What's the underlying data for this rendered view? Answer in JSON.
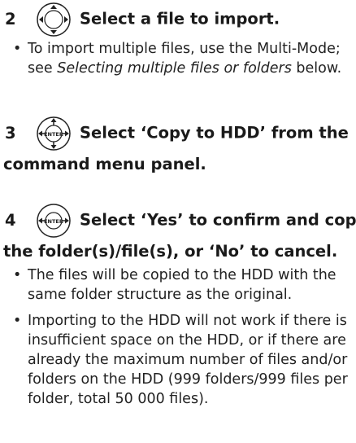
{
  "steps": [
    {
      "number": "2",
      "title": "Select a file to import.",
      "bullets": [
        {
          "before": "To import multiple files, use the Multi-Mode; see ",
          "italic": "Selecting multiple files or folders",
          "after": " below."
        }
      ]
    },
    {
      "number": "3",
      "title_line1": "Select ‘Copy to HDD’ from the",
      "title_line2": "command menu panel."
    },
    {
      "number": "4",
      "title_line1": "Select ‘Yes’ to confirm and copy",
      "title_line2": "the folder(s)/file(s), or ‘No’ to cancel.",
      "bullets": [
        "The files will be copied to the HDD with the same folder structure as the original.",
        "Importing to the HDD will not work if there is insufficient space on the HDD, or if there are already the maximum number of files and/or folders on the HDD (999 folders/999 files per folder, total 50 000 files)."
      ]
    }
  ],
  "icons": {
    "step2": "directional-pad-icon",
    "step3": "enter-four-arrows-icon",
    "step4": "enter-left-right-arrows-icon",
    "enter_label": "ENTER"
  }
}
